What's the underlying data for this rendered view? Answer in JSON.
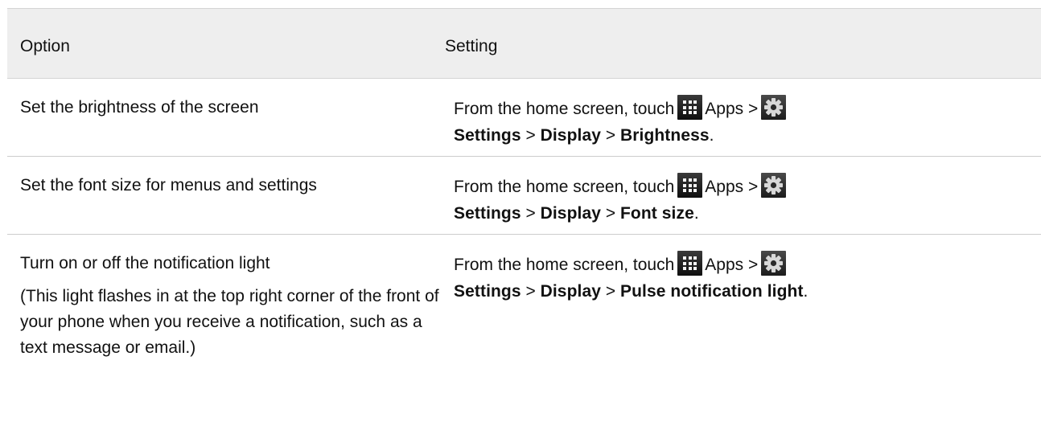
{
  "header": {
    "option": "Option",
    "setting": "Setting"
  },
  "rows": [
    {
      "option": "Set the brightness of the screen",
      "note": "",
      "path_prefix": "From the home screen, touch",
      "apps": "Apps",
      "sep": ">",
      "settings": "Settings",
      "display": "Display",
      "final": "Brightness",
      "end": "."
    },
    {
      "option": "Set the font size for menus and settings",
      "note": "",
      "path_prefix": "From the home screen, touch",
      "apps": "Apps",
      "sep": ">",
      "settings": "Settings",
      "display": "Display",
      "final": "Font size",
      "end": "."
    },
    {
      "option": "Turn on or off the notification light",
      "note": "(This light flashes in at the top right corner of the front of your phone when you receive a notification, such as a text message or email.)",
      "path_prefix": "From the home screen, touch",
      "apps": "Apps",
      "sep": ">",
      "settings": "Settings",
      "display": "Display",
      "final": "Pulse notification light",
      "end": "."
    }
  ],
  "icons": {
    "apps": "apps-grid-icon",
    "settings": "settings-gear-icon"
  },
  "colors": {
    "header_bg": "#eeeeee",
    "icon_bg": "#1a1a1a",
    "divider": "#cccccc"
  }
}
